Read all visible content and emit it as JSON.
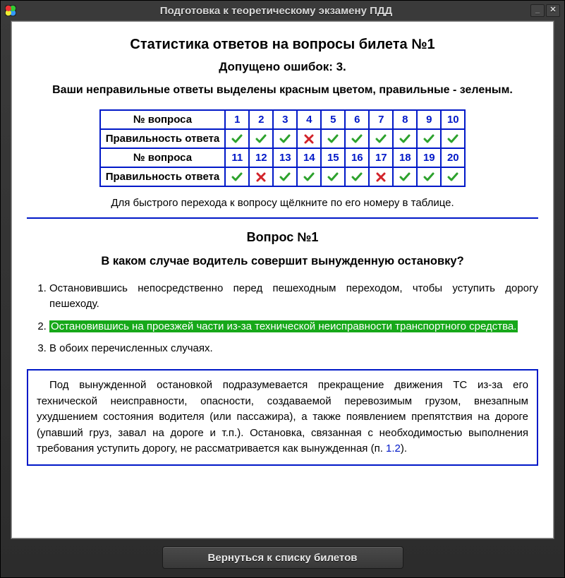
{
  "window": {
    "title": "Подготовка к теоретическому экзамену ПДД"
  },
  "stats": {
    "heading": "Статистика ответов на вопросы билета №1",
    "mistakes_line": "Допущено ошибок: 3.",
    "legend": "Ваши неправильные ответы выделены красным цветом, правильные - зеленым.",
    "row_label_num": "№ вопроса",
    "row_label_correct": "Правильность ответа",
    "questions": [
      {
        "n": 1,
        "ok": true
      },
      {
        "n": 2,
        "ok": true
      },
      {
        "n": 3,
        "ok": true
      },
      {
        "n": 4,
        "ok": false
      },
      {
        "n": 5,
        "ok": true
      },
      {
        "n": 6,
        "ok": true
      },
      {
        "n": 7,
        "ok": true
      },
      {
        "n": 8,
        "ok": true
      },
      {
        "n": 9,
        "ok": true
      },
      {
        "n": 10,
        "ok": true
      },
      {
        "n": 11,
        "ok": true
      },
      {
        "n": 12,
        "ok": false
      },
      {
        "n": 13,
        "ok": true
      },
      {
        "n": 14,
        "ok": true
      },
      {
        "n": 15,
        "ok": true
      },
      {
        "n": 16,
        "ok": true
      },
      {
        "n": 17,
        "ok": false
      },
      {
        "n": 18,
        "ok": true
      },
      {
        "n": 19,
        "ok": true
      },
      {
        "n": 20,
        "ok": true
      }
    ],
    "hint": "Для быстрого перехода к вопросу щёлкните по его номеру в таблице."
  },
  "question": {
    "heading": "Вопрос №1",
    "text": "В каком случае водитель совершит вынужденную остановку?",
    "answers": [
      {
        "text": "Остановившись непосредственно перед пешеходным переходом, чтобы уступить дорогу пешеходу.",
        "state": "plain"
      },
      {
        "text": "Остановившись на проезжей части из-за технической неисправности транспортного средства.",
        "state": "correct"
      },
      {
        "text": "В обоих перечисленных случаях.",
        "state": "plain"
      }
    ],
    "explanation_pre": "Под вынужденной остановкой подразумевается прекращение движения ТС из-за его технической неисправности, опасности, создаваемой перевозимым грузом, внезапным ухудшением состояния водителя (или пассажира), а также появлением препятствия на дороге (упавший груз, завал на дороге и т.п.). Остановка, связанная с необходимостью выполнения требования уступить дорогу, не рассматривается как вынужденная (п. ",
    "explanation_link": "1.2",
    "explanation_post": ")."
  },
  "footer": {
    "back_label": "Вернуться к списку билетов"
  }
}
